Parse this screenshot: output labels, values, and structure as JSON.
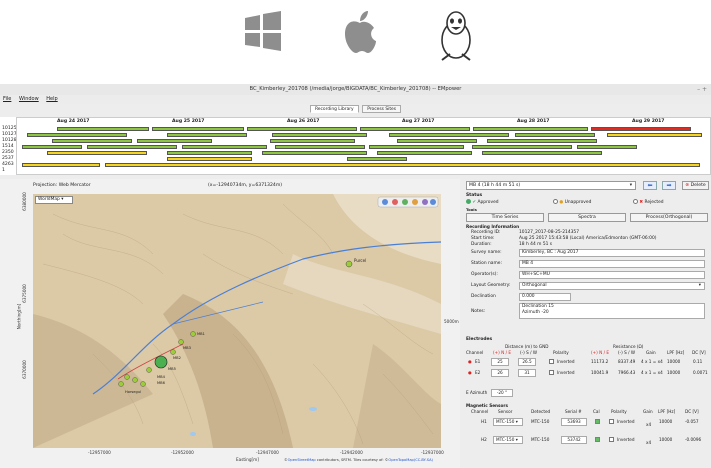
{
  "window": {
    "title": "BC_Kimberley_201708 (/media/jorge/BIGDATA/BC_Kimberley_201708) -- EMpower",
    "controls": "– +"
  },
  "menu": [
    "File",
    "Window",
    "Help"
  ],
  "tabs": [
    "Recording Library",
    "Process Sites"
  ],
  "timeline": {
    "days": [
      "Aug 24 2017",
      "Aug 25 2017",
      "Aug 26 2017",
      "Aug 27 2017",
      "Aug 28 2017",
      "Aug 29 2017"
    ],
    "rows": [
      "10125",
      "10127",
      "10128",
      "1514",
      "2350",
      "2537",
      "4263",
      "1"
    ]
  },
  "map": {
    "projection": "Projection: Web Mercator",
    "cursor": "(x=-12940734m, y=6371324m)",
    "basemap": "WorldMap",
    "easting_label": "Easting[m]",
    "northing_label": "Northing[m]",
    "x_ticks": [
      "-12957000",
      "-12952000",
      "-12947000",
      "-12942000",
      "-12937000"
    ],
    "y_ticks": [
      "6380000",
      "6375000",
      "6370000"
    ],
    "scale_label": "5000m",
    "place_label": "Purcel",
    "site_labels": [
      "MB1",
      "MB3",
      "MB2",
      "MB5",
      "MB4",
      "MB6",
      "Horsegul"
    ],
    "credit_prefix": "©",
    "credit_osm": "OpenStreetMap",
    "credit_mid": " contributors, SRTM. Tiles courtesy of: ©",
    "credit_otm": "OpenTopoMap(CC-BY-SA)"
  },
  "detail": {
    "selected_site": "MB 4 (18 h 44 m 51 s)",
    "delete_label": "Delete",
    "status_title": "Status",
    "status_options": [
      "Approved",
      "Unapproved",
      "Rejected"
    ],
    "tools_title": "Tools",
    "tool_buttons": [
      "Time Series",
      "Spectra",
      "Process(Orthogonal)"
    ],
    "rec_info_title": "Recording Information",
    "rec_fields": [
      {
        "label": "Recording ID:",
        "value": "10127_2017-08-25-214357"
      },
      {
        "label": "Start time:",
        "value": "Aug 25 2017 15:43:58 (Local) America/Edmonton (GMT-06:00)"
      },
      {
        "label": "Duration:",
        "value": "18 h 44 m 51 s"
      }
    ],
    "survey_name_label": "Survey name:",
    "survey_name": "Kimberley, BC : Aug 2017",
    "station_name_label": "Station name:",
    "station_name": "MB 4",
    "operators_label": "Operator(s):",
    "operators": "WH+SC+MU",
    "layout_label": "Layout Geometry:",
    "layout": "Orthogonal",
    "declination_label": "Declination",
    "declination": "0.000",
    "notes_label": "Notes:",
    "notes_line1": "Declination 15",
    "notes_line2": "Azimuth -20"
  },
  "electrodes": {
    "title": "Electrodes",
    "dist_header": "Distance (m) to GND",
    "res_header": "Resistance (Ω)",
    "cols": [
      "Channel",
      "(+) N / E",
      "(-) S / W",
      "Polarity",
      "(+) N / E",
      "(-) S / W",
      "Gain",
      "LPF [Hz]",
      "DC [V]"
    ],
    "rows": [
      {
        "ch": "E1",
        "pos": "25",
        "neg": "26.5",
        "pol": "Inverted",
        "rp": "11173.2",
        "rn": "8337.49",
        "gain": "4 x 1 = x4",
        "lpf": "10000",
        "dc": "0.11"
      },
      {
        "ch": "E2",
        "pos": "26",
        "neg": "31",
        "pol": "Inverted",
        "rp": "10041.9",
        "rn": "7966.43",
        "gain": "4 x 1 = x4",
        "lpf": "10000",
        "dc": "0.0071"
      }
    ],
    "azimuth_label": "E Azimuth",
    "azimuth": "-20 °"
  },
  "magnetic": {
    "title": "Magnetic Sensors",
    "cols": [
      "Channel",
      "Sensor",
      "Detected",
      "Serial #",
      "Cal",
      "Polarity",
      "Gain",
      "LPF [Hz]",
      "DC [V]"
    ],
    "rows": [
      {
        "ch": "H1",
        "sensor": "MTC-150",
        "det": "MTC-150",
        "serial": "53693",
        "pol": "Inverted",
        "gain": "x4",
        "lpf": "10000",
        "dc": "-0.057"
      },
      {
        "ch": "H2",
        "sensor": "MTC-150",
        "det": "MTC-150",
        "serial": "53742",
        "pol": "Inverted",
        "gain": "x4",
        "lpf": "10000",
        "dc": "-0.0096"
      }
    ]
  },
  "colors": {
    "accent": "#3367c7",
    "approved": "#44aa44",
    "rejected": "#dd2222",
    "bar_green": "#8dc63f",
    "bar_yellow": "#f7d51d",
    "bar_red": "#e8281f"
  }
}
